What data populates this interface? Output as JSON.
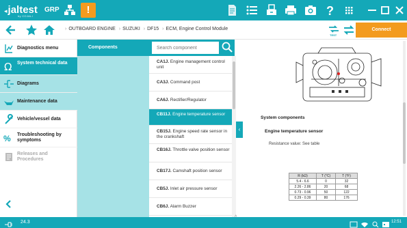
{
  "header": {
    "brand": "jaltest",
    "brand_sub": "by COJALI",
    "group": "GRP",
    "alert": "!",
    "connect_label": "Connect",
    "toolbar_icons": [
      "document-icon",
      "list-icon",
      "print-icon",
      "printer-icon",
      "camera-icon",
      "help-icon",
      "apps-icon"
    ]
  },
  "breadcrumb": {
    "items": [
      "OUTBOARD ENGINE",
      "SUZUKI",
      "DF15",
      "ECM, Engine Control Module"
    ]
  },
  "sidebar": {
    "items": [
      {
        "label": "Diagnostics menu",
        "icon": "diagnostics-icon"
      },
      {
        "label": "System technical data",
        "icon": "ohm-icon"
      },
      {
        "label": "Diagrams",
        "icon": "diagram-icon"
      },
      {
        "label": "Maintenance data",
        "icon": "oil-can-icon"
      },
      {
        "label": "Vehicle/vessel data",
        "icon": "wrench-icon"
      },
      {
        "label": "Troubleshooting by symptoms",
        "icon": "troubleshooting-icon"
      },
      {
        "label": "Releases and Procedures",
        "icon": "procedures-icon"
      }
    ]
  },
  "components": {
    "header": "Components",
    "search_placeholder": "Search component",
    "items": [
      {
        "code": "CA1J.",
        "name": "Engine management control unit"
      },
      {
        "code": "CA3J.",
        "name": "Command post"
      },
      {
        "code": "CA6J.",
        "name": "Rectifier/Regulator"
      },
      {
        "code": "CB11J.",
        "name": "Engine temperature sensor"
      },
      {
        "code": "CB15J.",
        "name": "Engine speed rate sensor in the crankshaft"
      },
      {
        "code": "CB16J.",
        "name": "Throttle valve position sensor"
      },
      {
        "code": "CB17J.",
        "name": "Camshaft position sensor"
      },
      {
        "code": "CB5J.",
        "name": "Inlet air pressure sensor"
      },
      {
        "code": "CB6J.",
        "name": "Alarm Buzzer"
      }
    ],
    "selected_index": 3
  },
  "detail": {
    "title": "System components",
    "subtitle": "Engine temperature sensor",
    "resistance": "Resistance value: See table",
    "table": {
      "headers": [
        "R (kΩ)",
        "T (°C)",
        "T (°F)"
      ],
      "rows": [
        [
          "5.4 - 6.6",
          "0",
          "32"
        ],
        [
          "2.26 - 2.86",
          "20",
          "68"
        ],
        [
          "0.73 - 0.96",
          "50",
          "122"
        ],
        [
          "0.29 - 0.39",
          "80",
          "176"
        ]
      ]
    }
  },
  "status": {
    "voltage": "24.3",
    "time": "12:51"
  }
}
